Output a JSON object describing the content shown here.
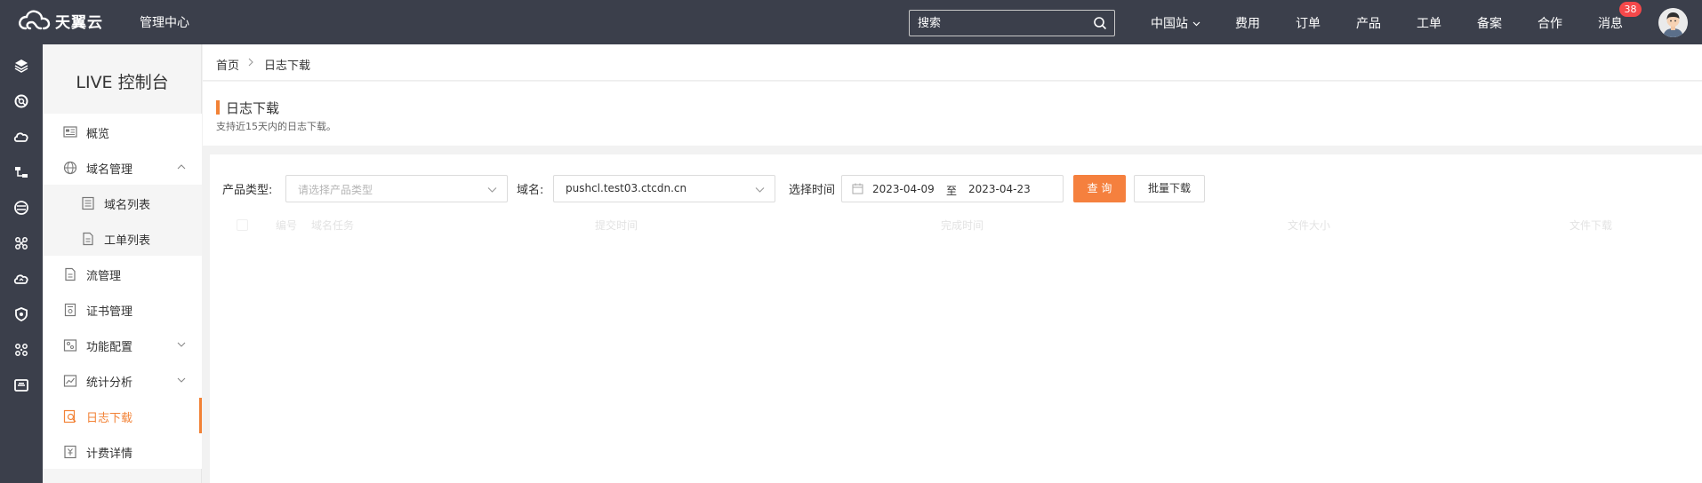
{
  "topbar": {
    "logo_text": "天翼云",
    "title": "管理中心",
    "search_placeholder": "搜索",
    "nav": [
      "中国站",
      "费用",
      "订单",
      "产品",
      "工单",
      "备案",
      "合作",
      "消息"
    ],
    "message_count": "38"
  },
  "icon_strip": [
    "layers-icon",
    "support-icon",
    "cloud-icon",
    "network-icon",
    "database-icon",
    "nodes-icon",
    "cloud-upload-icon",
    "shield-icon",
    "cluster-icon",
    "monitor-icon"
  ],
  "sidebar": {
    "title": "LIVE 控制台",
    "items": [
      {
        "label": "概览",
        "icon": "overview-icon"
      },
      {
        "label": "域名管理",
        "icon": "globe-icon",
        "expanded": true
      },
      {
        "label": "域名列表",
        "icon": "list-icon",
        "sub": true
      },
      {
        "label": "工单列表",
        "icon": "doc-icon",
        "sub": true
      },
      {
        "label": "流管理",
        "icon": "doc-icon"
      },
      {
        "label": "证书管理",
        "icon": "certificate-icon"
      },
      {
        "label": "功能配置",
        "icon": "config-icon",
        "collapsed": true
      },
      {
        "label": "统计分析",
        "icon": "chart-icon",
        "collapsed": true
      },
      {
        "label": "日志下载",
        "icon": "log-download-icon",
        "active": true
      },
      {
        "label": "计费详情",
        "icon": "billing-icon"
      }
    ]
  },
  "breadcrumb": {
    "home": "首页",
    "current": "日志下载"
  },
  "header": {
    "title": "日志下载",
    "subtitle": "支持近15天内的日志下载。"
  },
  "filters": {
    "product_label": "产品类型:",
    "product_placeholder": "请选择产品类型",
    "domain_label": "域名:",
    "domain_value": "pushcl.test03.ctcdn.cn",
    "time_label": "选择时间",
    "start_date": "2023-04-09",
    "to": "至",
    "end_date": "2023-04-23",
    "query_button": "查 询",
    "batch_button": "批量下载"
  },
  "table": {
    "columns": [
      "编号",
      "域名任务",
      "提交时间",
      "完成时间",
      "文件大小",
      "文件下载"
    ]
  },
  "colors": {
    "accent": "#f28236",
    "topbar": "#3b3f4b",
    "badge": "#f5484a"
  }
}
